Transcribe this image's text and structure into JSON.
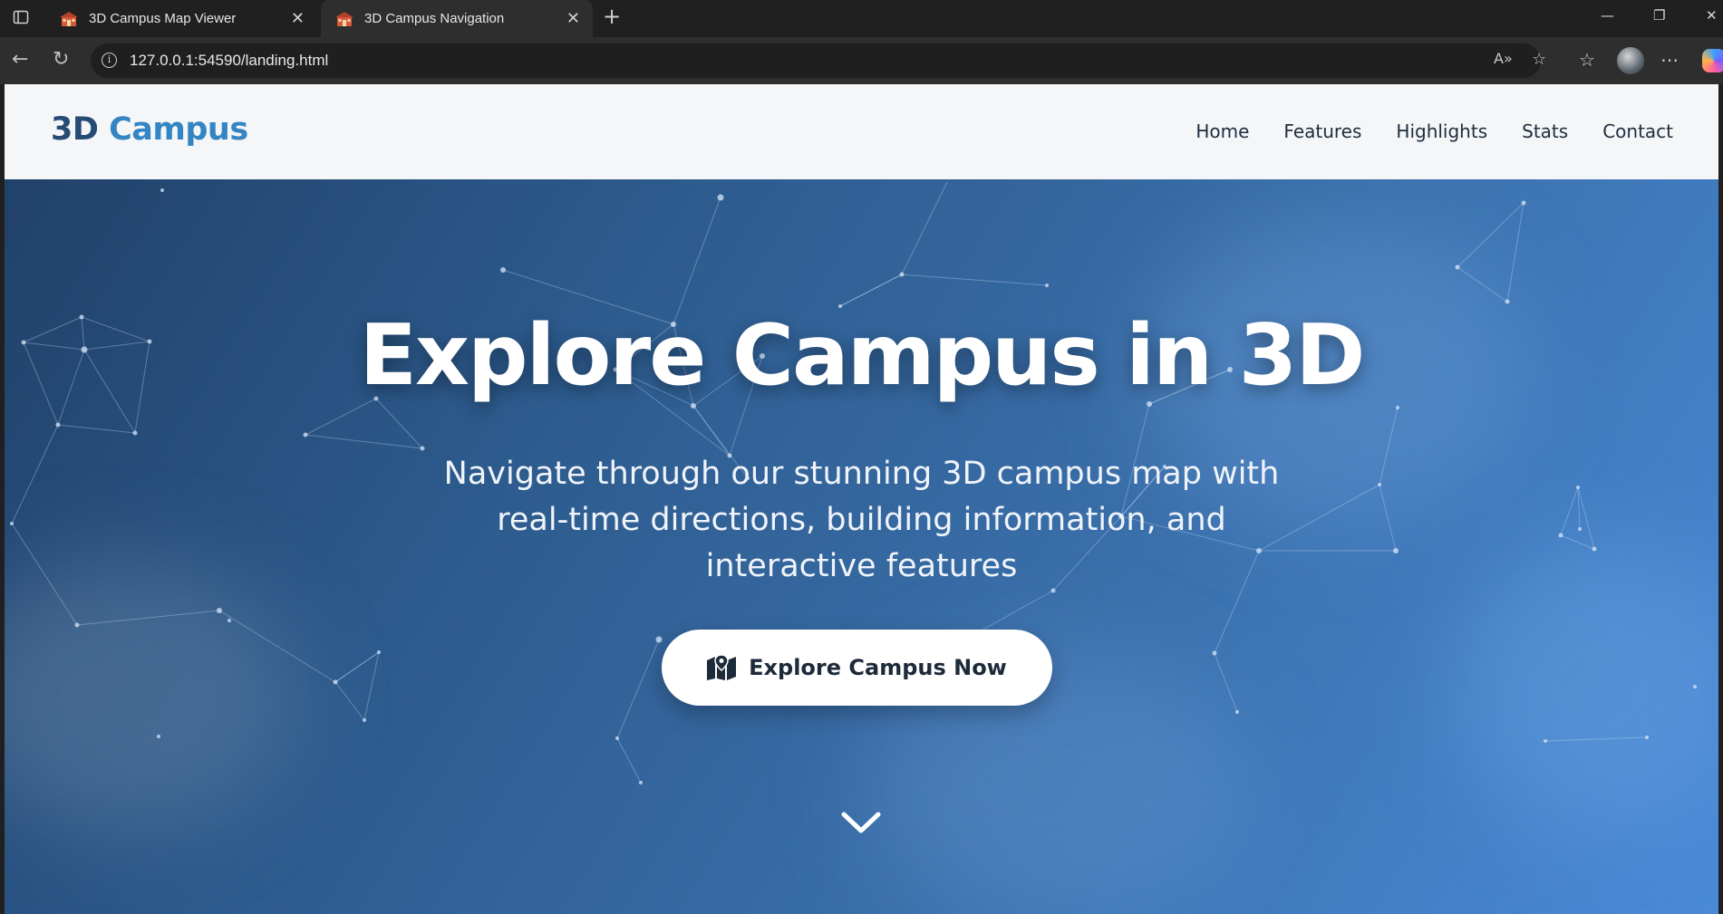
{
  "browser": {
    "tabs": [
      {
        "title": "3D Campus Map Viewer",
        "active": false
      },
      {
        "title": "3D Campus Navigation",
        "active": true
      }
    ],
    "url": "127.0.0.1:54590/landing.html"
  },
  "site": {
    "logo": {
      "part1": "3D",
      "part2": "Campus"
    },
    "nav": [
      "Home",
      "Features",
      "Highlights",
      "Stats",
      "Contact"
    ],
    "hero": {
      "title": "Explore Campus in 3D",
      "subtitle": "Navigate through our stunning 3D campus map with real-time directions, building information, and interactive features",
      "cta_label": "Explore Campus Now"
    }
  },
  "colors": {
    "logo_dark": "#264c73",
    "logo_accent": "#3485c4",
    "hero_gradient_start": "#21416a",
    "hero_gradient_end": "#4a8ad8",
    "cta_background": "#ffffff"
  },
  "icons": {
    "tab_actions": "tab-actions-icon",
    "favicon": "school-building-icon",
    "cta": "map-marker-icon",
    "scroll": "chevron-down-icon"
  }
}
